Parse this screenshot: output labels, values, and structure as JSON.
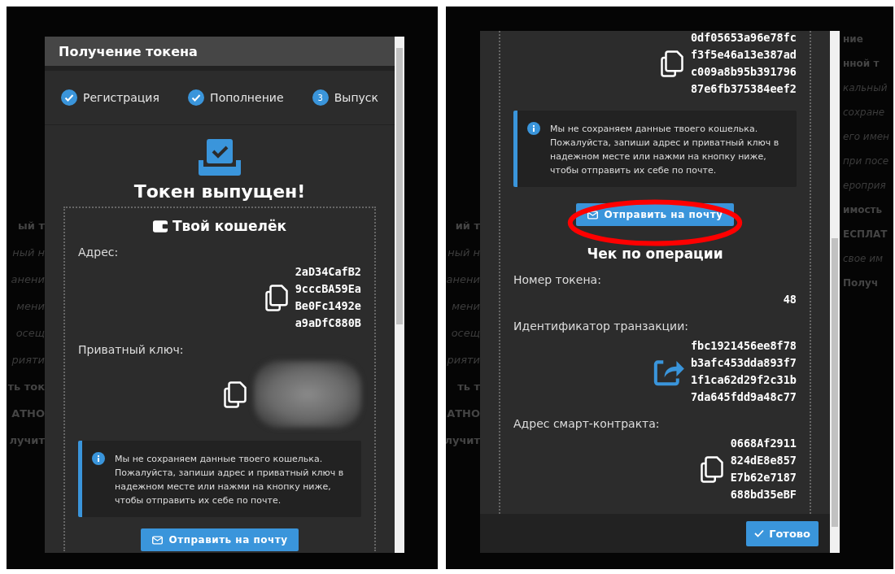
{
  "left_panel": {
    "background_left": [
      {
        "text": "ый т",
        "kind": "heading"
      },
      {
        "text": "ный н",
        "kind": "body"
      },
      {
        "text": "анени",
        "kind": "body"
      },
      {
        "text": "мени",
        "kind": "body"
      },
      {
        "text": "осещ",
        "kind": "body"
      },
      {
        "text": "рияти",
        "kind": "body"
      },
      {
        "text": "ть ток",
        "kind": "heading"
      },
      {
        "text": "АТНО",
        "kind": "heading"
      },
      {
        "text": "лучит",
        "kind": "heading"
      }
    ],
    "modal": {
      "title": "Получение токена",
      "steps": [
        {
          "label": "Регистрация",
          "completed": true
        },
        {
          "label": "Пополнение",
          "completed": true
        },
        {
          "label": "Выпуск",
          "completed": false,
          "number": "3"
        }
      ],
      "success_title": "Токен выпущен!",
      "wallet": {
        "title": "Твой кошелёк",
        "address_label": "Адрес:",
        "address_lines": [
          "2aD34CafB2",
          "9cccBA59Ea",
          "Be0Fc1492e",
          "a9aDfC880B"
        ],
        "private_key_label": "Приватный ключ:"
      },
      "notice": "Мы не сохраняем данные твоего кошелька. Пожалуйста, запиши адрес и приватный ключ в надежном месте или нажми на кнопку ниже, чтобы отправить их себе по почте.",
      "email_button": "Отправить на почту"
    }
  },
  "right_panel": {
    "background_left": [
      {
        "text": "ий т",
        "kind": "heading"
      },
      {
        "text": "ный н",
        "kind": "body"
      },
      {
        "text": "анени",
        "kind": "body"
      },
      {
        "text": "мени",
        "kind": "body"
      },
      {
        "text": "осещ",
        "kind": "body"
      },
      {
        "text": "рияти",
        "kind": "body"
      },
      {
        "text": "ть т",
        "kind": "heading"
      },
      {
        "text": "АТНО",
        "kind": "heading"
      },
      {
        "text": "лучит",
        "kind": "heading"
      }
    ],
    "background_right": [
      {
        "text": "ние",
        "kind": "heading"
      },
      {
        "text": "нной т",
        "kind": "heading"
      },
      {
        "text": "кальный",
        "kind": "body"
      },
      {
        "text": "сохране",
        "kind": "body"
      },
      {
        "text": "его имен",
        "kind": "body"
      },
      {
        "text": "при посе",
        "kind": "body"
      },
      {
        "text": "ероприя",
        "kind": "body"
      },
      {
        "text": "имость",
        "kind": "heading"
      },
      {
        "text": "ЕСПЛАТ",
        "kind": "heading"
      },
      {
        "text": "свое им",
        "kind": "body"
      },
      {
        "text": "Получ",
        "kind": "heading"
      }
    ],
    "modal": {
      "key_lines": [
        "0df05653a96e78fc",
        "f3f5e46a13e387ad",
        "c009a8b95b391796",
        "87e6fb375384eef2"
      ],
      "notice": "Мы не сохраняем данные твоего кошелька. Пожалуйста, запиши адрес и приватный ключ в надежном месте или нажми на кнопку ниже, чтобы отправить их себе по почте.",
      "email_button": "Отправить на почту",
      "email_button_circled": true,
      "receipt": {
        "title": "Чек по операции",
        "fields": [
          {
            "label": "Номер токена:",
            "lines": [
              "48"
            ],
            "kind": "number"
          },
          {
            "label": "Идентификатор транзакции:",
            "lines": [
              "fbc1921456ee8f78",
              "b3afc453dda893f7",
              "1f1ca62d29f2c31b",
              "7da645fdd9a48c77"
            ],
            "kind": "transaction"
          },
          {
            "label": "Адрес смарт-контракта:",
            "lines": [
              "0668Af2911",
              "824dE8e857",
              "E7b62e7187",
              "688bd35eBF"
            ],
            "kind": "address"
          }
        ]
      },
      "done_button": "Готово"
    }
  }
}
